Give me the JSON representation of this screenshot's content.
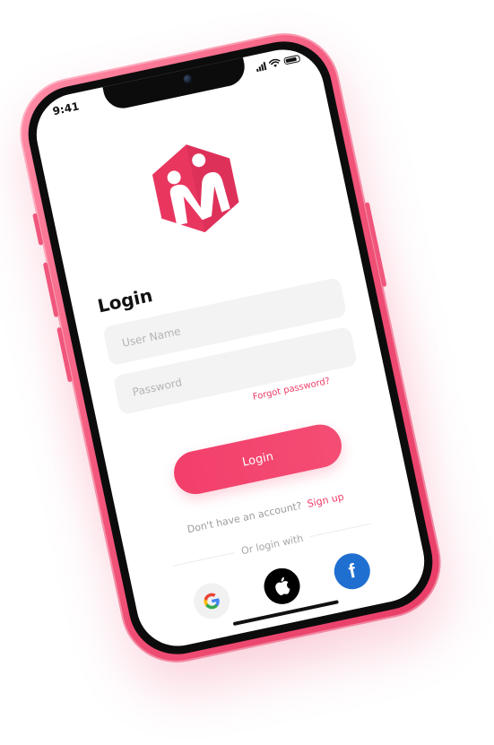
{
  "status_bar": {
    "time": "9:41"
  },
  "login": {
    "title": "Login",
    "username_placeholder": "User Name",
    "password_placeholder": "Password",
    "forgot_label": "Forgot password?",
    "submit_label": "Login"
  },
  "signup": {
    "prompt": "Don't have an account?",
    "link_label": "Sign up"
  },
  "social": {
    "divider_label": "Or login with",
    "providers": [
      {
        "icon": "google-icon"
      },
      {
        "icon": "apple-icon"
      },
      {
        "icon": "facebook-icon"
      }
    ]
  },
  "colors": {
    "accent": "#ef3c67",
    "phone_body": "#f2557a",
    "facebook": "#1f6fd1",
    "field_bg": "#f3f3f3"
  }
}
